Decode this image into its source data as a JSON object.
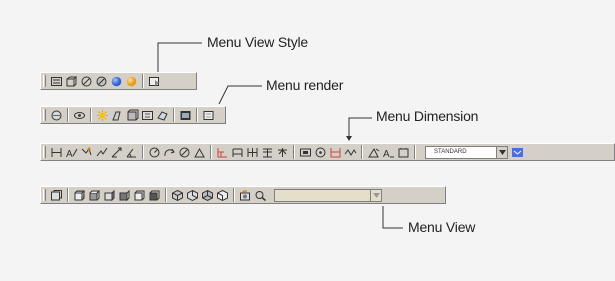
{
  "labels": {
    "view_style": "Menu View Style",
    "render": "Menu render",
    "dimension": "Menu Dimension",
    "view": "Menu View"
  },
  "toolbars": {
    "view_style": {
      "icons": [
        "2d-wireframe-icon",
        "3d-wireframe-icon",
        "hidden-icon",
        "flat-shaded-icon",
        "gouraud-shaded-icon",
        "flat-edges-icon",
        "gouraud-edges-icon"
      ]
    },
    "render": {
      "icons": [
        "hide-icon",
        "render-icon",
        "scene-icon",
        "lights-icon",
        "materials-icon",
        "materials-library-icon",
        "mapping-icon",
        "background-icon",
        "fog-icon"
      ]
    },
    "dimension": {
      "icons": [
        "linear-dim-icon",
        "aligned-dim-icon",
        "ordinate-dim-icon",
        "radius-dim-icon",
        "diameter-dim-icon",
        "angular-dim-icon",
        "quick-dim-icon",
        "baseline-dim-icon",
        "continue-dim-icon",
        "leader-icon",
        "tolerance-icon",
        "center-mark-icon",
        "dim-edit-icon",
        "dim-text-edit-icon",
        "dim-update-icon"
      ],
      "style_combo_value": "STANDARD"
    },
    "view": {
      "icons": [
        "named-views-icon",
        "top-view-icon",
        "bottom-view-icon",
        "left-view-icon",
        "right-view-icon",
        "front-view-icon",
        "back-view-icon",
        "sw-iso-icon",
        "se-iso-icon",
        "ne-iso-icon",
        "nw-iso-icon",
        "camera-icon",
        "view-dropdown-icon"
      ],
      "combo_value": ""
    }
  },
  "colors": {
    "toolbar_bg": "#d4d0c8",
    "combo_bg": "#e4dfc8",
    "blue_sphere": "#2f5fd0",
    "orange_sphere": "#e89a18",
    "dropdown_blue": "#4a6fd8"
  }
}
